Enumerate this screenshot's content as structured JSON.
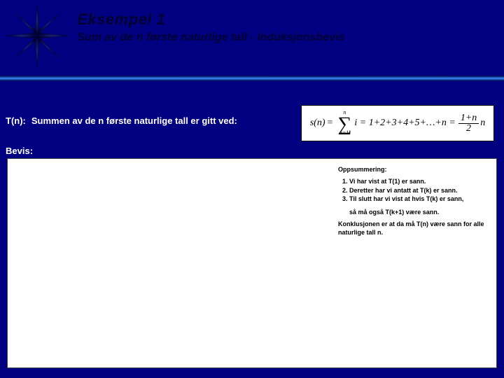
{
  "header": {
    "title": "Eksempel 1",
    "subtitle": "Sum av de n første naturlige tall   -   Induksjonsbevis"
  },
  "tn": {
    "label": "T(n):",
    "text": "Summen av de n første naturlige tall er gitt ved:"
  },
  "formula": {
    "lhs": "s(n)",
    "sum_upper": "n",
    "sum_lower": "i=1",
    "mid": "i = 1+2+3+4+5+…+n =",
    "frac_num": "1+n",
    "frac_den": "2",
    "trail": "n"
  },
  "proof": {
    "label": "Bevis:"
  },
  "summary": {
    "heading": "Oppsummering:",
    "items": [
      "Vi har vist at T(1) er sann.",
      "Deretter har vi antatt at T(k) er sann.",
      "Til slutt har vi vist at hvis T(k) er sann,"
    ],
    "item3_extra": "så må også T(k+1) være sann.",
    "conclusion": "Konklusjonen er at da må T(n) være sann for alle naturlige tall n."
  }
}
